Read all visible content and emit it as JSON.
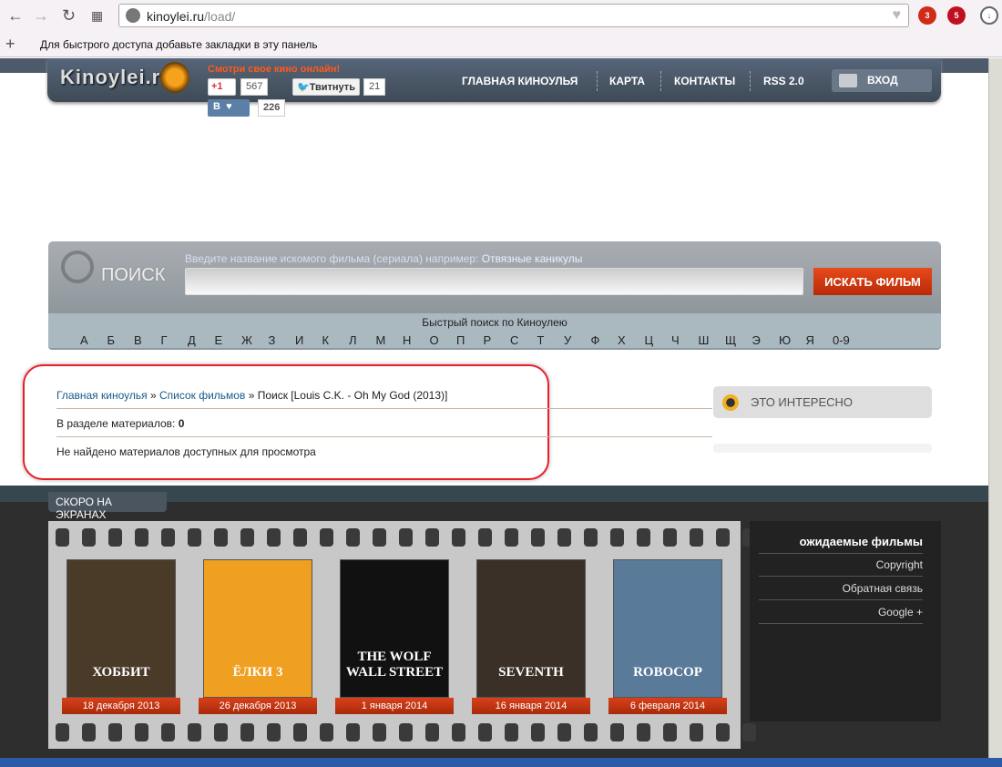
{
  "browser": {
    "url_host": "kinoylei.ru",
    "url_path": "/load/",
    "bookmarks_hint": "Для быстрого доступа добавьте закладки в эту панель",
    "ext_abp_count": "3",
    "ext_block_count": "5"
  },
  "header": {
    "logo": "Kinoylei.ru",
    "slogan": "Смотри свое кино онлайн!",
    "gplus_label": "+1",
    "gplus_count": "567",
    "tweet_label": "Твитнуть",
    "tweet_count": "21",
    "vk_label": "B",
    "vk_count": "226",
    "nav": [
      "ГЛАВНАЯ КИНОУЛЬЯ",
      "КАРТА",
      "КОНТАКТЫ",
      "RSS 2.0"
    ],
    "login": "ВХОД"
  },
  "search": {
    "label": "ПОИСК",
    "hint": "Введите название искомого фильма (сериала) например:",
    "hint_example": "Отвязные каникулы",
    "value": "",
    "button": "ИСКАТЬ ФИЛЬМ",
    "quick_title": "Быстрый поиск по Киноулею",
    "letters": [
      "А",
      "Б",
      "В",
      "Г",
      "Д",
      "Е",
      "Ж",
      "З",
      "И",
      "К",
      "Л",
      "М",
      "Н",
      "О",
      "П",
      "Р",
      "С",
      "Т",
      "У",
      "Ф",
      "Х",
      "Ц",
      "Ч",
      "Ш",
      "Щ",
      "Э",
      "Ю",
      "Я",
      "0-9"
    ]
  },
  "content": {
    "crumb_home": "Главная киноулья",
    "crumb_sep": " » ",
    "crumb_list": "Список фильмов",
    "crumb_current": " » Поиск [Louis C.K. - Oh My God (2013)]",
    "count_label": "В разделе материалов: ",
    "count": "0",
    "empty": "Не найдено материалов доступных для просмотра"
  },
  "sidebar": {
    "interesting": "ЭТО ИНТЕРЕСНО"
  },
  "soon": {
    "title": "СКОРО НА ЭКРАНАХ",
    "movies": [
      {
        "poster": "ХОББИТ",
        "date": "18 декабря 2013",
        "bg": "#4a3a28"
      },
      {
        "poster": "ЁЛКИ 3",
        "date": "26 декабря 2013",
        "bg": "#f0a020"
      },
      {
        "poster": "THE WOLF WALL STREET",
        "date": "1 января 2014",
        "bg": "#111111"
      },
      {
        "poster": "SEVENTH",
        "date": "16 января 2014",
        "bg": "#3a3028"
      },
      {
        "poster": "ROBOCOP",
        "date": "6 февраля 2014",
        "bg": "#5a7a9a"
      }
    ]
  },
  "footer_links": {
    "title": "ожидаемые фильмы",
    "items": [
      "Copyright",
      "Обратная связь",
      "Google +"
    ]
  }
}
